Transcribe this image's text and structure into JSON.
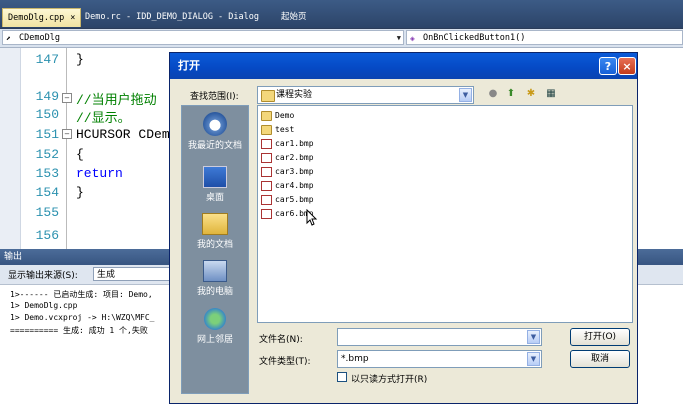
{
  "tabs": [
    {
      "label": "DemoDlg.cpp",
      "close": "×"
    },
    {
      "label": "Demo.rc - IDD_DEMO_DIALOG - Dialog"
    },
    {
      "label": "起始页"
    }
  ],
  "nav": {
    "class_combo": "CDemoDlg",
    "member_combo": "OnBnClickedButton1()"
  },
  "editor": {
    "lines": [
      {
        "num": "147",
        "text": "}"
      },
      {
        "num": "149",
        "text": "//当用户拖动"
      },
      {
        "num": "150",
        "text": "//显示。"
      },
      {
        "num": "151",
        "text": "HCURSOR CDem"
      },
      {
        "num": "152",
        "text": "{"
      },
      {
        "num": "153",
        "text": "    return"
      },
      {
        "num": "154",
        "text": "}"
      },
      {
        "num": "155",
        "text": ""
      },
      {
        "num": "156",
        "text": ""
      }
    ]
  },
  "output": {
    "title": "输出",
    "source_label": "显示输出来源(S):",
    "source_value": "生成",
    "lines": [
      "1>------ 已启动生成: 项目: Demo,",
      "1>  DemoDlg.cpp",
      "1>  Demo.vcxproj -> H:\\WZQ\\MFC_",
      "========== 生成: 成功 1 个,失败"
    ]
  },
  "dialog": {
    "title": "打开",
    "help": "?",
    "close": "×",
    "lookin_label": "查找范围(I):",
    "lookin_value": "课程实验",
    "places": [
      "我最近的文档",
      "桌面",
      "我的文档",
      "我的电脑",
      "网上邻居"
    ],
    "files": [
      {
        "name": "Demo",
        "type": "folder"
      },
      {
        "name": "test",
        "type": "folder"
      },
      {
        "name": "car1.bmp",
        "type": "bmp"
      },
      {
        "name": "car2.bmp",
        "type": "bmp"
      },
      {
        "name": "car3.bmp",
        "type": "bmp"
      },
      {
        "name": "car4.bmp",
        "type": "bmp"
      },
      {
        "name": "car5.bmp",
        "type": "bmp"
      },
      {
        "name": "car6.bmp",
        "type": "bmp"
      }
    ],
    "filename_label": "文件名(N):",
    "filename_value": "",
    "filetype_label": "文件类型(T):",
    "filetype_value": "*.bmp",
    "readonly_label": "以只读方式打开(R)",
    "open_button": "打开(O)",
    "cancel_button": "取消"
  }
}
